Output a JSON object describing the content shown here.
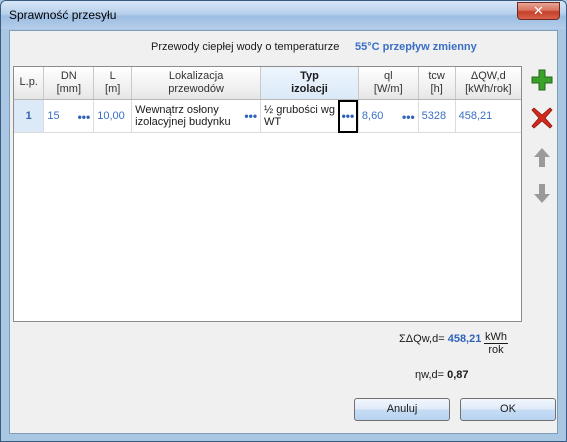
{
  "window": {
    "title": "Sprawność przesyłu",
    "close_glyph": "✕"
  },
  "header": {
    "label": "Przewody ciepłej wody o temperaturze",
    "temperature_value": "55°C przepływ zmienny"
  },
  "table": {
    "columns": [
      {
        "line1": "L.p.",
        "line2": ""
      },
      {
        "line1": "DN",
        "line2": "[mm]"
      },
      {
        "line1": "L",
        "line2": "[m]"
      },
      {
        "line1": "Lokalizacja",
        "line2": "przewodów"
      },
      {
        "line1": "Typ",
        "line2": "izolacji"
      },
      {
        "line1": "ql",
        "line2": "[W/m]"
      },
      {
        "line1": "tcw",
        "line2": "[h]"
      },
      {
        "line1": "ΔQW,d",
        "line2": "[kWh/rok]"
      }
    ],
    "rows": [
      {
        "lp": "1",
        "dn": "15",
        "l": "10,00",
        "lokalizacja": "Wewnątrz osłony izolacyjnej budynku",
        "typ": "½ grubości wg WT",
        "ql": "8,60",
        "tcw": "5328",
        "dq": "458,21"
      }
    ],
    "ellipsis": "•••"
  },
  "side_buttons": [
    {
      "name": "add-row-button",
      "icon": "plus-icon"
    },
    {
      "name": "delete-row-button",
      "icon": "x-icon"
    },
    {
      "name": "move-up-button",
      "icon": "arrow-up-icon"
    },
    {
      "name": "move-down-button",
      "icon": "arrow-down-icon"
    }
  ],
  "summary": {
    "sum_label": "ΣΔQw,d=",
    "sum_value": "458,21",
    "unit_num": "kWh",
    "unit_den": "rok",
    "eta_label": "ηw,d=",
    "eta_value": "0,87"
  },
  "buttons": {
    "cancel": "Anuluj",
    "ok": "OK"
  },
  "colors": {
    "accent": "#3a6fc4",
    "add": "#3aa02a",
    "delete": "#d42a1c",
    "arrow": "#9a9a9a"
  }
}
